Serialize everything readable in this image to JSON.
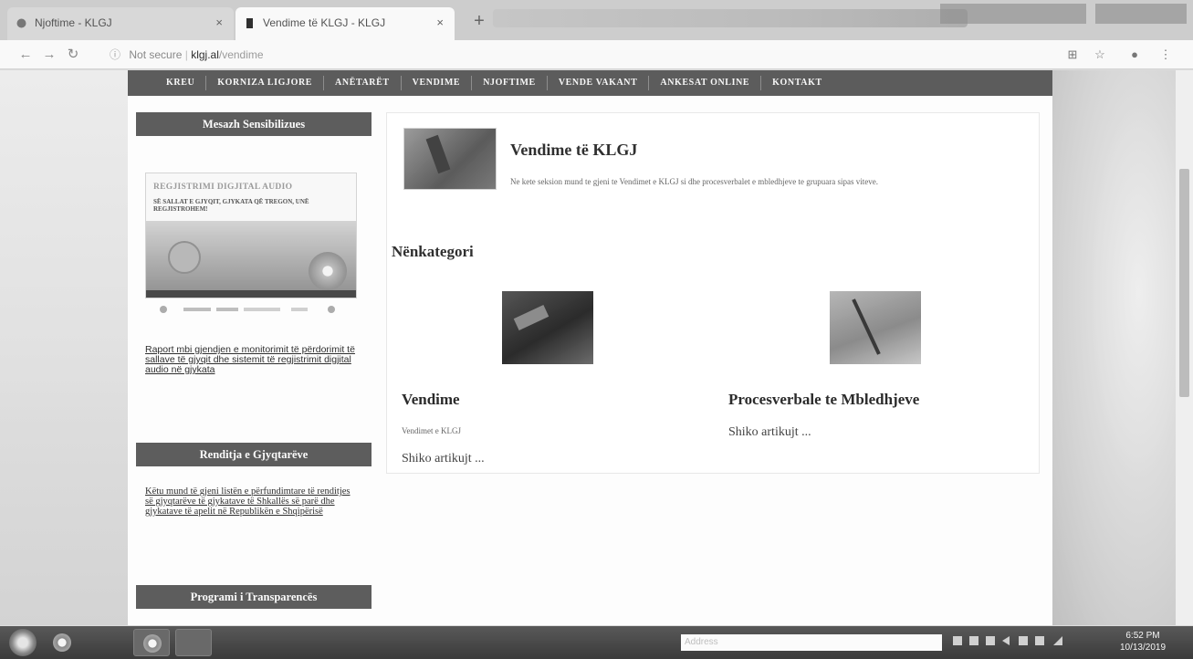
{
  "browser": {
    "tabs": [
      {
        "title": "Njoftime - KLGJ",
        "active": false
      },
      {
        "title": "Vendime të KLGJ - KLGJ",
        "active": true
      }
    ],
    "new_tab_label": "+",
    "close_glyph": "×",
    "address": {
      "security_label": "Not secure",
      "domain": "klgj.al",
      "path": "/vendime"
    },
    "nav_icons": [
      "back-icon",
      "forward-icon",
      "reload-icon"
    ],
    "right_icons": [
      "translate-icon",
      "star-icon",
      "profile-icon",
      "menu-icon"
    ]
  },
  "site": {
    "nav": [
      "KREU",
      "KORNIZA LIGJORE",
      "ANËTARËT",
      "VENDIME",
      "NJOFTIME",
      "VENDE VAKANT",
      "ANKESAT ONLINE",
      "KONTAKT"
    ],
    "sidebar": {
      "section1_title": "Mesazh Sensibilizues",
      "banner_title": "REGJISTRIMI DIGJITAL AUDIO",
      "banner_sub": "SË SALLAT E GJYQIT, GJYKATA QË TREGON, UNË REGJISTROHEM!",
      "link1": "Raport mbi gjendjen e monitorimit të përdorimit të sallave të gjyqit dhe sistemit të regjistrimit digjital audio në gjykata",
      "section2_title": "Renditja e Gjyqtarëve",
      "link2": "Këtu mund të gjeni listën e përfundimtare të renditjes së gjyqtarëve të gjykatave të Shkallës së parë dhe gjykatave të apelit në Republikën e Shqipërisë",
      "section3_title": "Programi i Transparencës"
    },
    "content": {
      "category_title": "Vendime të KLGJ",
      "category_desc": "Ne kete seksion mund te gjeni te Vendimet e KLGJ si dhe procesverbalet e mbledhjeve te grupuara sipas viteve.",
      "subcategories_heading": "Nënkategori",
      "subcats": [
        {
          "title": "Vendime",
          "desc": "Vendimet e KLGJ",
          "more": "Shiko artikujt ..."
        },
        {
          "title": "Procesverbale te Mbledhjeve",
          "desc": "",
          "more": "Shiko artikujt ..."
        }
      ]
    }
  },
  "taskbar": {
    "address_label": "Address",
    "time": "6:52 PM",
    "date": "10/13/2019"
  }
}
